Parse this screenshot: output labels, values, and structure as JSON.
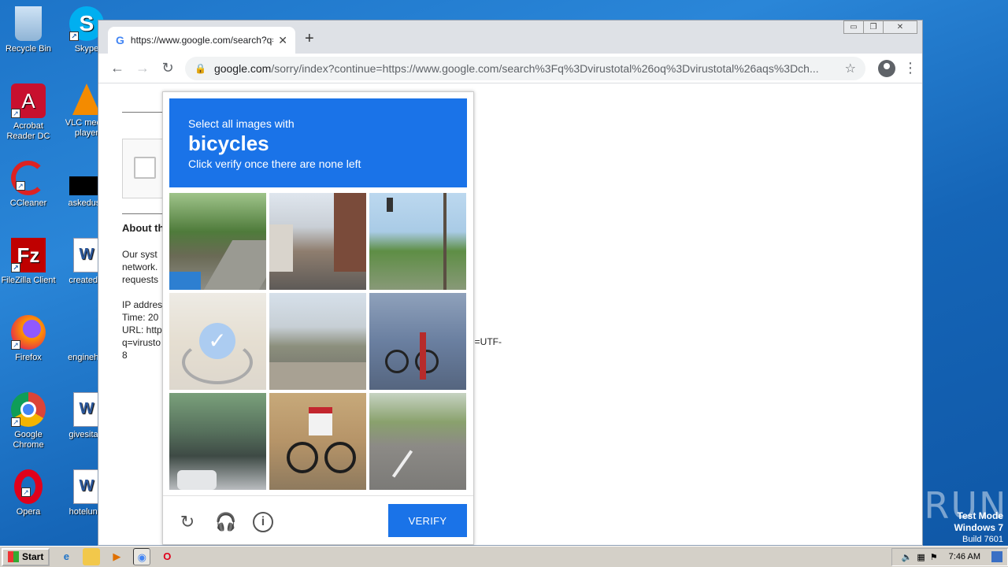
{
  "desktop": {
    "icons": [
      {
        "label": "Recycle Bin"
      },
      {
        "label": "Skype"
      },
      {
        "label": "Acrobat Reader DC"
      },
      {
        "label": "VLC media player"
      },
      {
        "label": "CCleaner"
      },
      {
        "label": "askeduse"
      },
      {
        "label": "FileZilla Client"
      },
      {
        "label": "createddi"
      },
      {
        "label": "Firefox"
      },
      {
        "label": "enginehig"
      },
      {
        "label": "Google Chrome"
      },
      {
        "label": "givesitaly"
      },
      {
        "label": "Opera"
      },
      {
        "label": "hotelundi"
      }
    ]
  },
  "browser": {
    "tab_title": "https://www.google.com/search?q=",
    "new_tab": "+",
    "url_host": "google.com",
    "url_rest": "/sorry/index?continue=https://www.google.com/search%3Fq%3Dvirustotal%26oq%3Dvirustotal%26aqs%3Dch..."
  },
  "page": {
    "about_title": "About th",
    "para1": [
      "Our syst",
      "network.",
      "requests"
    ],
    "para2": [
      "IP addres",
      "Time: 20",
      "URL: http",
      "q=virusto",
      "8"
    ],
    "tail": "e=UTF-"
  },
  "captcha": {
    "line1": "Select all images with",
    "target": "bicycles",
    "line3": "Click verify once there are none left",
    "verify_label": "VERIFY",
    "tiles": [
      {
        "name": "tile-road-greenery",
        "selected": false
      },
      {
        "name": "tile-city-street",
        "selected": false
      },
      {
        "name": "tile-intersection-trees",
        "selected": false
      },
      {
        "name": "tile-cyclist-faded",
        "selected": true
      },
      {
        "name": "tile-landscape-wall",
        "selected": false
      },
      {
        "name": "tile-cyclist-crosswalk",
        "selected": false
      },
      {
        "name": "tile-building-street",
        "selected": false
      },
      {
        "name": "tile-racing-cyclist",
        "selected": false
      },
      {
        "name": "tile-empty-road",
        "selected": false
      }
    ]
  },
  "watermark": {
    "brand": "ANY▷RUN",
    "mode": "Test Mode",
    "os": "Windows 7",
    "build": "Build 7601"
  },
  "taskbar": {
    "start_label": "Start",
    "clock": "7:46 AM"
  }
}
